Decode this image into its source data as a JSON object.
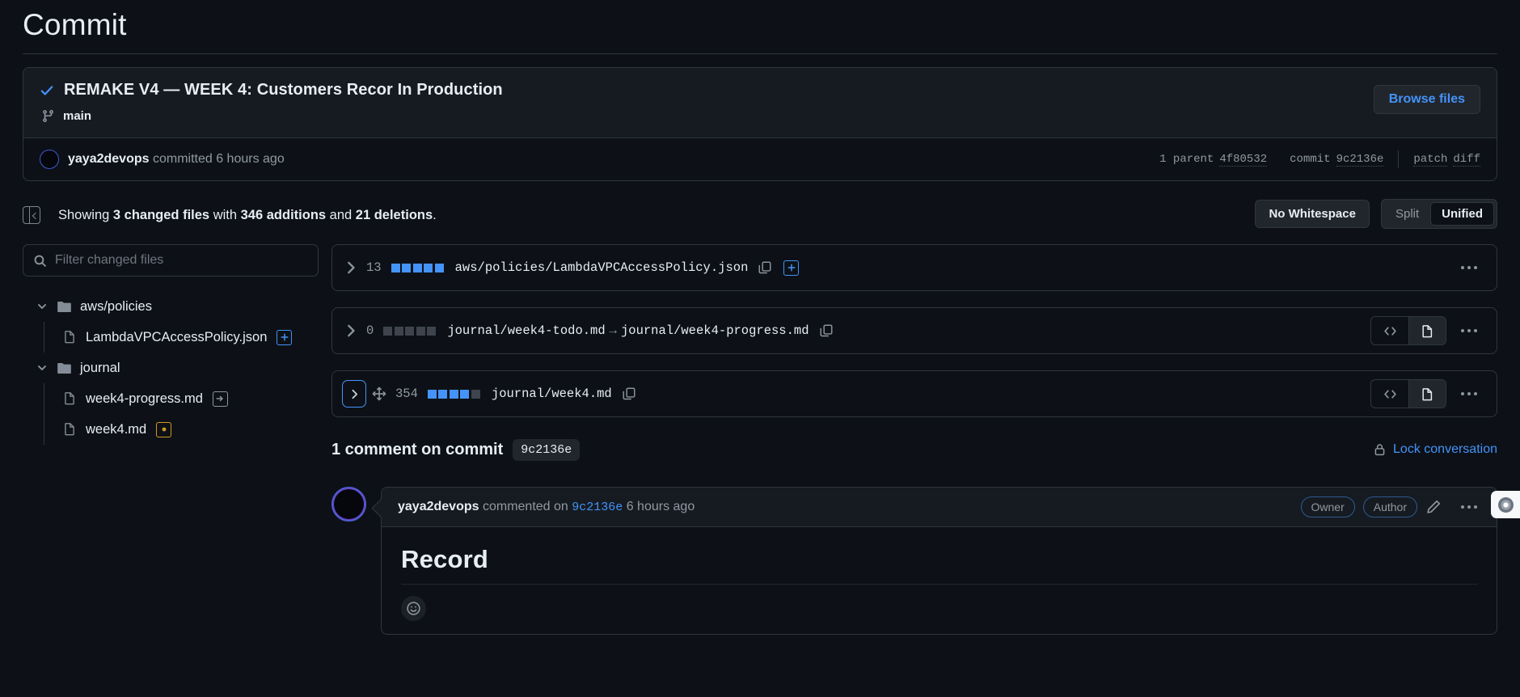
{
  "page": {
    "title": "Commit"
  },
  "commit": {
    "message": "REMAKE V4 — WEEK 4: Customers Recor In Production",
    "branch": "main",
    "browse_files_label": "Browse files",
    "author": "yaya2devops",
    "action_text": " committed ",
    "time": "6 hours ago",
    "parent_label": "1 parent",
    "parent_sha": "4f80532",
    "commit_label": "commit",
    "commit_sha": "9c2136e",
    "patch_label": "patch",
    "diff_label": "diff"
  },
  "toolbar": {
    "showing_prefix": "Showing ",
    "changed_files": "3 changed files",
    "with_text": " with ",
    "additions": "346 additions",
    "and_text": " and ",
    "deletions": "21 deletions",
    "period": ".",
    "no_whitespace_label": "No Whitespace",
    "split_label": "Split",
    "unified_label": "Unified"
  },
  "filetree": {
    "filter_placeholder": "Filter changed files",
    "filter_value": "",
    "nodes": [
      {
        "type": "folder",
        "label": "aws/policies"
      },
      {
        "type": "file",
        "label": "LambdaVPCAccessPolicy.json",
        "status": "added"
      },
      {
        "type": "folder",
        "label": "journal"
      },
      {
        "type": "file",
        "label": "week4-progress.md",
        "status": "renamed"
      },
      {
        "type": "file",
        "label": "week4.md",
        "status": "modified"
      }
    ]
  },
  "diff_files": [
    {
      "count": "13",
      "blocks": [
        "on",
        "on",
        "on",
        "on",
        "on"
      ],
      "path": "aws/policies/LambdaVPCAccessPolicy.json",
      "path_to": "",
      "status": "added",
      "has_view_toggle": false,
      "focused": false
    },
    {
      "count": "0",
      "blocks": [
        "off",
        "off",
        "off",
        "off",
        "off"
      ],
      "path": "journal/week4-todo.md",
      "path_to": "journal/week4-progress.md",
      "status": "renamed",
      "has_view_toggle": true,
      "focused": false
    },
    {
      "count": "354",
      "blocks": [
        "on",
        "on",
        "on",
        "on",
        "off"
      ],
      "path": "journal/week4.md",
      "path_to": "",
      "status": "modified",
      "has_view_toggle": true,
      "focused": true
    }
  ],
  "comments_section": {
    "heading": "1 comment on commit",
    "sha_badge": "9c2136e",
    "lock_label": "Lock conversation"
  },
  "comment": {
    "author": "yaya2devops",
    "commented_on": " commented on ",
    "sha": "9c2136e",
    "time": " 6 hours ago",
    "owner_badge": "Owner",
    "author_badge": "Author",
    "body_heading": "Record"
  },
  "colors": {
    "accent_blue": "#4493f8",
    "added_blue": "#4493f8",
    "modified_orange": "#d29922",
    "border": "#30363d",
    "bg": "#0d1117",
    "bg_subtle": "#161b22"
  }
}
